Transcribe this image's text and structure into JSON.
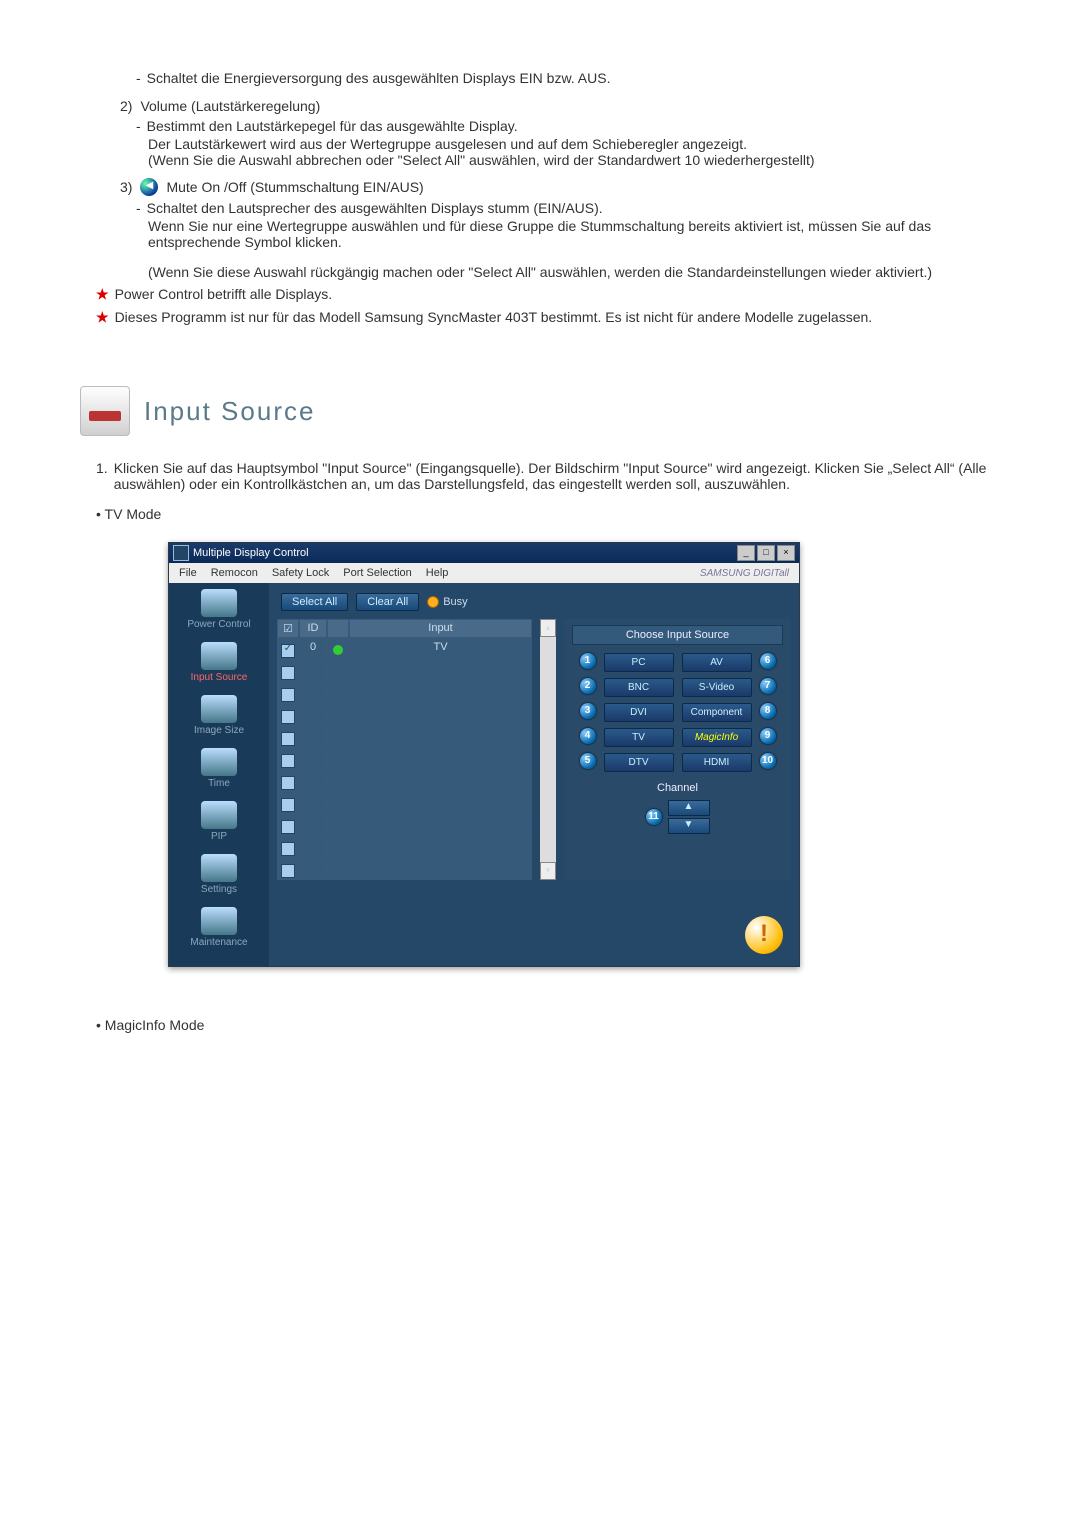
{
  "intro": {
    "power_off_text": "Schaltet die Energieversorgung des ausgewählten Displays EIN bzw. AUS."
  },
  "item2": {
    "num": "2)",
    "title": "Volume (Lautstärkeregelung)",
    "line1": "Bestimmt den Lautstärkepegel für das ausgewählte Display.",
    "line2": "Der Lautstärkewert wird aus der Wertegruppe ausgelesen und auf dem Schieberegler angezeigt.",
    "line3": "(Wenn Sie die Auswahl abbrechen oder \"Select All\" auswählen, wird der Standardwert 10 wiederhergestellt)"
  },
  "item3": {
    "num": "3)",
    "title": "Mute On /Off (Stummschaltung EIN/AUS)",
    "line1": "Schaltet den Lautsprecher des ausgewählten Displays stumm (EIN/AUS).",
    "line2": "Wenn Sie nur eine Wertegruppe auswählen und für diese Gruppe die Stummschaltung bereits aktiviert ist, müssen Sie auf das entsprechende Symbol klicken.",
    "line3": "(Wenn Sie diese Auswahl rückgängig machen oder \"Select All\" auswählen, werden die Standardeinstellungen wieder aktiviert.)"
  },
  "notes": {
    "n1": "Power Control betrifft alle Displays.",
    "n2": "Dieses Programm ist nur für das Modell Samsung SyncMaster 403T bestimmt. Es ist nicht für andere Modelle zugelassen."
  },
  "section": {
    "title": "Input Source",
    "desc": "Klicken Sie auf das Hauptsymbol \"Input Source\" (Eingangsquelle). Der Bildschirm \"Input Source\" wird angezeigt. Klicken Sie „Select All“ (Alle auswählen) oder ein Kontrollkästchen an, um das Darstellungsfeld, das eingestellt werden soll, auszuwählen.",
    "bullet_tv": "TV Mode",
    "bullet_magic": "MagicInfo Mode"
  },
  "app": {
    "title": "Multiple Display Control",
    "menus": [
      "File",
      "Remocon",
      "Safety Lock",
      "Port Selection",
      "Help"
    ],
    "logo": "SAMSUNG DIGITall",
    "sidebar": [
      {
        "label": "Power Control",
        "active": false
      },
      {
        "label": "Input Source",
        "active": true
      },
      {
        "label": "Image Size",
        "active": false
      },
      {
        "label": "Time",
        "active": false
      },
      {
        "label": "PIP",
        "active": false
      },
      {
        "label": "Settings",
        "active": false
      },
      {
        "label": "Maintenance",
        "active": false
      }
    ],
    "toolbar": {
      "select_all": "Select All",
      "clear_all": "Clear All",
      "busy": "Busy"
    },
    "table": {
      "headers": {
        "chk": "☑",
        "id": "ID",
        "status": "●",
        "input": "Input"
      },
      "rows": [
        {
          "checked": true,
          "id": "0",
          "status": "g",
          "input": "TV"
        },
        {
          "checked": false,
          "id": "",
          "status": "",
          "input": ""
        },
        {
          "checked": false,
          "id": "",
          "status": "",
          "input": ""
        },
        {
          "checked": false,
          "id": "",
          "status": "",
          "input": ""
        },
        {
          "checked": false,
          "id": "",
          "status": "",
          "input": ""
        },
        {
          "checked": false,
          "id": "",
          "status": "",
          "input": ""
        },
        {
          "checked": false,
          "id": "",
          "status": "",
          "input": ""
        },
        {
          "checked": false,
          "id": "",
          "status": "",
          "input": ""
        },
        {
          "checked": false,
          "id": "",
          "status": "",
          "input": ""
        },
        {
          "checked": false,
          "id": "",
          "status": "",
          "input": ""
        },
        {
          "checked": false,
          "id": "",
          "status": "",
          "input": ""
        }
      ]
    },
    "panel": {
      "title": "Choose Input Source",
      "left": [
        {
          "n": "1",
          "l": "PC"
        },
        {
          "n": "2",
          "l": "BNC"
        },
        {
          "n": "3",
          "l": "DVI"
        },
        {
          "n": "4",
          "l": "TV"
        },
        {
          "n": "5",
          "l": "DTV"
        }
      ],
      "right": [
        {
          "n": "6",
          "l": "AV"
        },
        {
          "n": "7",
          "l": "S-Video"
        },
        {
          "n": "8",
          "l": "Component"
        },
        {
          "n": "9",
          "l": "MagicInfo"
        },
        {
          "n": "10",
          "l": "HDMI"
        }
      ],
      "channel_label": "Channel",
      "channel_callout": "11"
    }
  }
}
